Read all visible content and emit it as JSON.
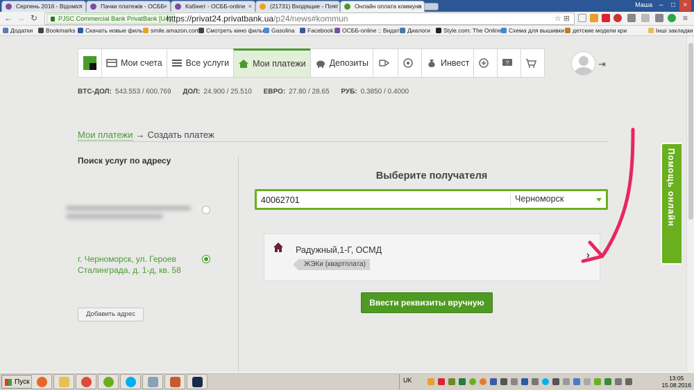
{
  "browser": {
    "tabs": [
      {
        "title": "Серпень 2016 - Відоміст",
        "color": "#7a4fa0"
      },
      {
        "title": "Пачки платежів - ОСББ-",
        "color": "#7a4fa0"
      },
      {
        "title": "Кабінет - ОСББ-online",
        "color": "#7a4fa0"
      },
      {
        "title": "(21731) Входящие - Почт",
        "color": "#f0a020"
      },
      {
        "title": "Онлайн оплата коммуна",
        "color": "#4b9a2c"
      }
    ],
    "window_user": "Маша",
    "secure_label": "PJSC Commercial Bank PrivatBank [UA]",
    "url_host": "https://privat24.privatbank.ua",
    "url_path": "/p24/news#kommun",
    "bookmarks": [
      {
        "label": "Додатки",
        "color": "#5a7ab8"
      },
      {
        "label": "Bookmarks",
        "color": "#444"
      },
      {
        "label": "Скачать новые филь",
        "color": "#2a5aa8"
      },
      {
        "label": "smile.amazon.com",
        "color": "#e8a02a"
      },
      {
        "label": "Смотреть кино филы",
        "color": "#444"
      },
      {
        "label": "Gasolina",
        "color": "#4a8ad8"
      },
      {
        "label": "Facebook",
        "color": "#3b5998"
      },
      {
        "label": "ОСББ-online :: Видат",
        "color": "#7a4fa0"
      },
      {
        "label": "Диалоги",
        "color": "#4a76a8"
      },
      {
        "label": "Style.com: The Online",
        "color": "#222"
      },
      {
        "label": "Схема для вышивки",
        "color": "#3a8ad8"
      },
      {
        "label": "детские модели кри",
        "color": "#c07a2a"
      },
      {
        "label": "Інші закладки",
        "color": "#e8c050"
      }
    ]
  },
  "nav": {
    "items": [
      {
        "label": "Мои счета"
      },
      {
        "label": "Все услуги"
      },
      {
        "label": "Мои платежи"
      },
      {
        "label": "Депозиты"
      },
      {
        "label": "Инвест"
      }
    ]
  },
  "rates": [
    {
      "name": "BTC-ДОЛ:",
      "value": "543.553 / 600.769"
    },
    {
      "name": "ДОЛ:",
      "value": "24.900 / 25.510"
    },
    {
      "name": "ЕВРО:",
      "value": "27.80 / 28.65"
    },
    {
      "name": "РУБ:",
      "value": "0.3850 / 0.4000"
    }
  ],
  "breadcrumb": {
    "link": "Мои платежи",
    "arrow": "→",
    "current": "Создать платеж"
  },
  "left": {
    "title": "Поиск услуг по адресу",
    "address_selected": "г. Черноморск, ул. Героев Сталинграда, д. 1-д, кв. 58",
    "add_button": "Добавить адрес"
  },
  "main": {
    "title": "Выберите получателя",
    "search_value": "40062701",
    "city": "Черноморск",
    "result": {
      "name": "Радужный,1-Г, ОСМД",
      "tag": "ЖЭКи (квартплата)"
    },
    "manual_button": "Ввести реквизиты вручную"
  },
  "help_tab": "Помощь онлайн",
  "taskbar": {
    "start": "Пуск",
    "lang": "UK",
    "time": "13:05",
    "date": "15.08.2016"
  },
  "colors": {
    "brand_green": "#4b9a2c",
    "accent_green": "#6ab01e",
    "annotation_arrow": "#e8265e"
  }
}
